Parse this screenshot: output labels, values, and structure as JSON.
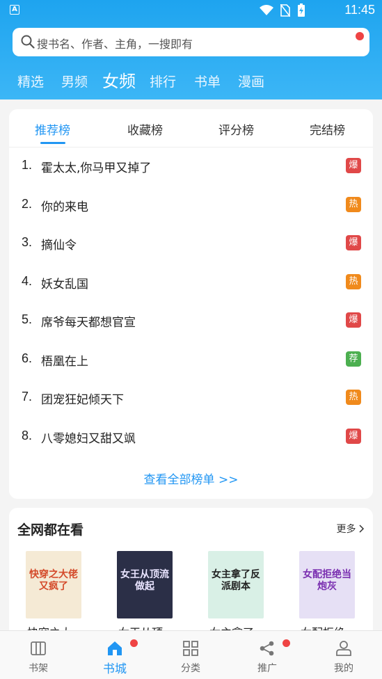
{
  "status_bar": {
    "time": "11:45",
    "app_badge": "A"
  },
  "search": {
    "placeholder": "搜书名、作者、主角，一搜即有"
  },
  "categories": [
    {
      "label": "精选",
      "active": false
    },
    {
      "label": "男频",
      "active": false
    },
    {
      "label": "女频",
      "active": true
    },
    {
      "label": "排行",
      "active": false
    },
    {
      "label": "书单",
      "active": false
    },
    {
      "label": "漫画",
      "active": false
    }
  ],
  "rank_tabs": [
    {
      "label": "推荐榜",
      "active": true
    },
    {
      "label": "收藏榜",
      "active": false
    },
    {
      "label": "评分榜",
      "active": false
    },
    {
      "label": "完结榜",
      "active": false
    }
  ],
  "rankings": [
    {
      "num": "1.",
      "title": "霍太太,你马甲又掉了",
      "tag": "爆",
      "tag_color": "#e04848"
    },
    {
      "num": "2.",
      "title": "你的来电",
      "tag": "热",
      "tag_color": "#f08a1c"
    },
    {
      "num": "3.",
      "title": "摘仙令",
      "tag": "爆",
      "tag_color": "#e04848"
    },
    {
      "num": "4.",
      "title": "妖女乱国",
      "tag": "热",
      "tag_color": "#f08a1c"
    },
    {
      "num": "5.",
      "title": "席爷每天都想官宣",
      "tag": "爆",
      "tag_color": "#e04848"
    },
    {
      "num": "6.",
      "title": "梧凰在上",
      "tag": "荐",
      "tag_color": "#4caf50"
    },
    {
      "num": "7.",
      "title": "团宠狂妃倾天下",
      "tag": "热",
      "tag_color": "#f08a1c"
    },
    {
      "num": "8.",
      "title": "八零媳妇又甜又飒",
      "tag": "爆",
      "tag_color": "#e04848"
    }
  ],
  "view_all": "查看全部榜单 >>",
  "trending": {
    "heading": "全网都在看",
    "more": "更多",
    "books": [
      {
        "cover_text": "快穿之大佬又疯了",
        "title": "快穿之大",
        "bg": "#f5ead5",
        "fg": "#d44a2a"
      },
      {
        "cover_text": "女王从顶流做起",
        "title": "女王从顶",
        "bg": "#2b2f47",
        "fg": "#e9e4ff"
      },
      {
        "cover_text": "女主拿了反派剧本",
        "title": "女主拿了",
        "bg": "#d9f0e6",
        "fg": "#222222"
      },
      {
        "cover_text": "女配拒绝当炮灰",
        "title": "女配拒绝",
        "bg": "#e6e0f5",
        "fg": "#7a2fb0"
      }
    ]
  },
  "bottom_nav": [
    {
      "label": "书架",
      "icon": "bookshelf-icon",
      "active": false,
      "badge": false
    },
    {
      "label": "书城",
      "icon": "home-icon",
      "active": true,
      "badge": true
    },
    {
      "label": "分类",
      "icon": "category-icon",
      "active": false,
      "badge": false
    },
    {
      "label": "推广",
      "icon": "share-icon",
      "active": false,
      "badge": true
    },
    {
      "label": "我的",
      "icon": "user-icon",
      "active": false,
      "badge": false
    }
  ],
  "colors": {
    "primary": "#2196f3",
    "header": "#29aef2",
    "hot_red": "#e04848",
    "hot_orange": "#f08a1c",
    "rec_green": "#4caf50"
  }
}
